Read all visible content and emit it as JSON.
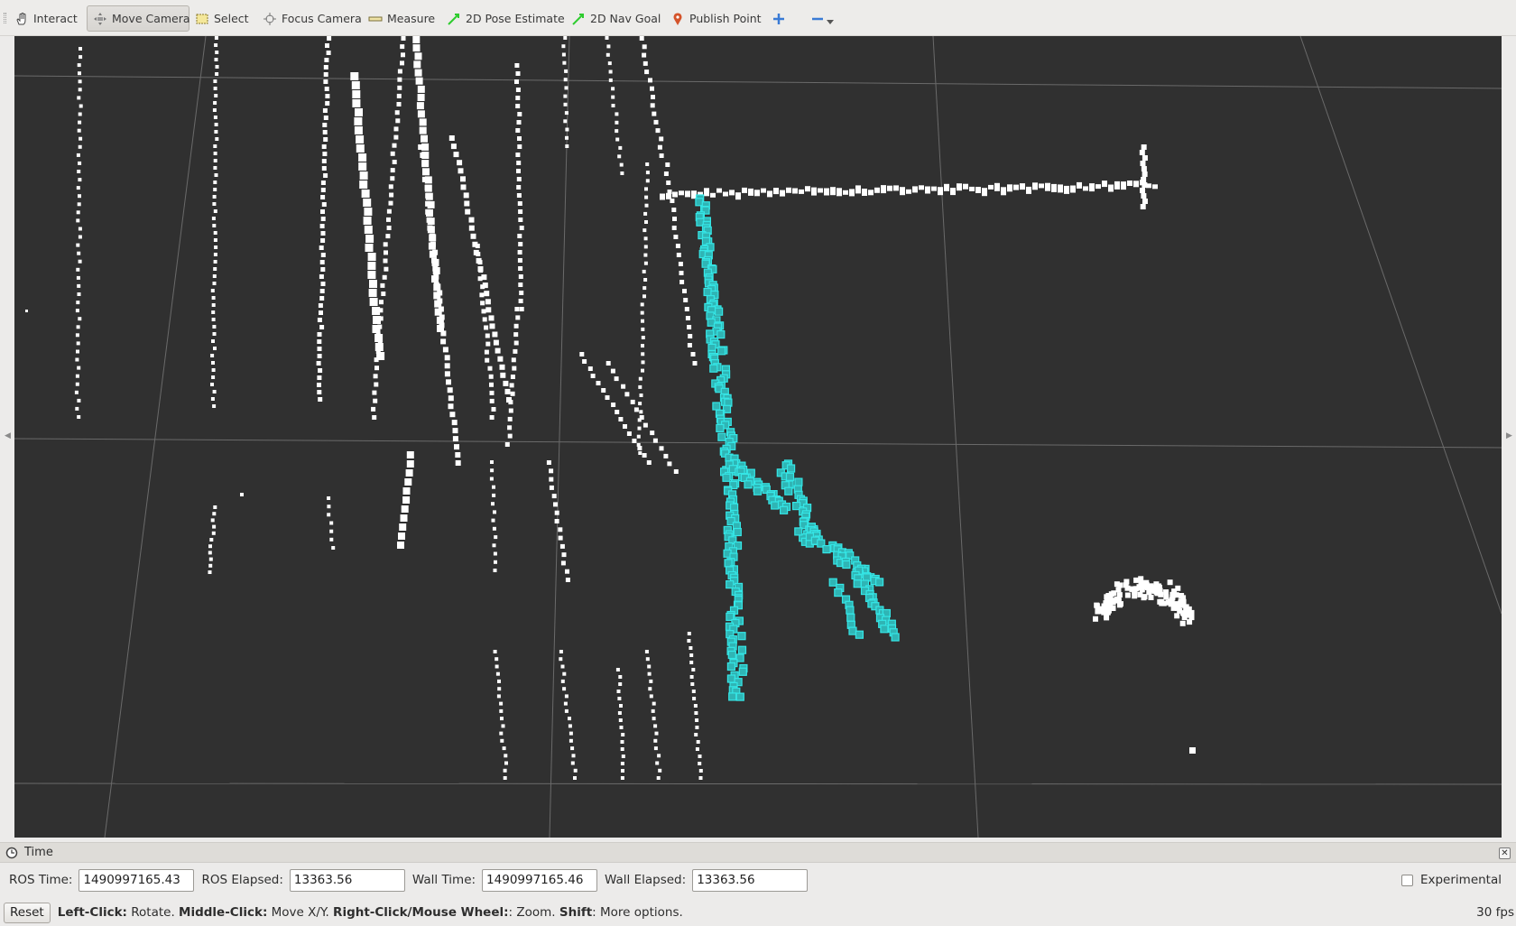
{
  "toolbar": {
    "tools": [
      {
        "label": "Interact",
        "icon": "hand-icon",
        "active": false
      },
      {
        "label": "Move Camera",
        "icon": "move-camera-icon",
        "active": true
      },
      {
        "label": "Select",
        "icon": "select-icon",
        "active": false
      },
      {
        "label": "Focus Camera",
        "icon": "focus-camera-icon",
        "active": false
      },
      {
        "label": "Measure",
        "icon": "measure-icon",
        "active": false
      },
      {
        "label": "2D Pose Estimate",
        "icon": "pose-arrow-icon",
        "active": false
      },
      {
        "label": "2D Nav Goal",
        "icon": "nav-goal-arrow-icon",
        "active": false
      },
      {
        "label": "Publish Point",
        "icon": "map-pin-icon",
        "active": false
      }
    ],
    "add_tool_icon": "plus-icon",
    "remove_tool_icon": "minus-icon",
    "menu_icon": "dropdown-icon"
  },
  "viewport": {
    "background": "#303030",
    "highlight_color": "#35e6e6",
    "point_color": "#ffffff"
  },
  "time_panel": {
    "title": "Time",
    "ros_time_label": "ROS Time:",
    "ros_time_value": "1490997165.43",
    "ros_elapsed_label": "ROS Elapsed:",
    "ros_elapsed_value": "13363.56",
    "wall_time_label": "Wall Time:",
    "wall_time_value": "1490997165.46",
    "wall_elapsed_label": "Wall Elapsed:",
    "wall_elapsed_value": "13363.56",
    "experimental_label": "Experimental",
    "experimental_checked": false
  },
  "status": {
    "reset_label": "Reset",
    "hint_parts": [
      {
        "text": "Left-Click:",
        "bold": true
      },
      {
        "text": " Rotate. ",
        "bold": false
      },
      {
        "text": "Middle-Click:",
        "bold": true
      },
      {
        "text": " Move X/Y. ",
        "bold": false
      },
      {
        "text": "Right-Click/Mouse Wheel:",
        "bold": true
      },
      {
        "text": ": Zoom. ",
        "bold": false
      },
      {
        "text": "Shift",
        "bold": true
      },
      {
        "text": ": More options.",
        "bold": false
      }
    ],
    "fps": "30 fps"
  }
}
